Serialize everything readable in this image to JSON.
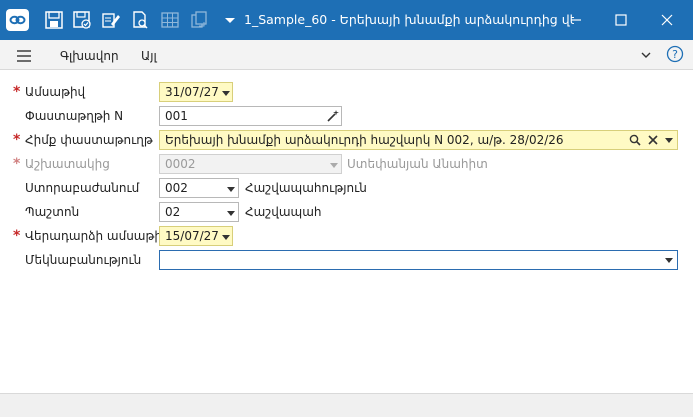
{
  "window": {
    "title": "1_Sample_60 - Երեխայի խնամքի արձակուրդից վեր...",
    "accent": "#1e6fb5"
  },
  "toolbar": {
    "menu_items": [
      "Գլխավոր",
      "Այլ"
    ]
  },
  "form": {
    "date": {
      "label": "Ամսաթիվ",
      "value": "31/07/27"
    },
    "doc_number": {
      "label": "Փաստաթղթի N",
      "value": "001"
    },
    "basis_doc": {
      "label": "Հիմք փաստաթուղթ",
      "value": "Երեխայի խնամքի արձակուրդի հաշվարկ N 002, ա/թ. 28/02/26"
    },
    "employee": {
      "label": "Աշխատակից",
      "value": "0002",
      "name": "Ստեփանյան Անահիտ"
    },
    "division": {
      "label": "Ստորաբաժանում",
      "value": "002",
      "name": "Հաշվապահություն"
    },
    "position": {
      "label": "Պաշտոն",
      "value": "02",
      "name": "Հաշվապահ"
    },
    "return_date": {
      "label": "Վերադարձի ամսաթիվ",
      "value": "15/07/27"
    },
    "comment": {
      "label": "Մեկնաբանություն",
      "value": ""
    }
  }
}
